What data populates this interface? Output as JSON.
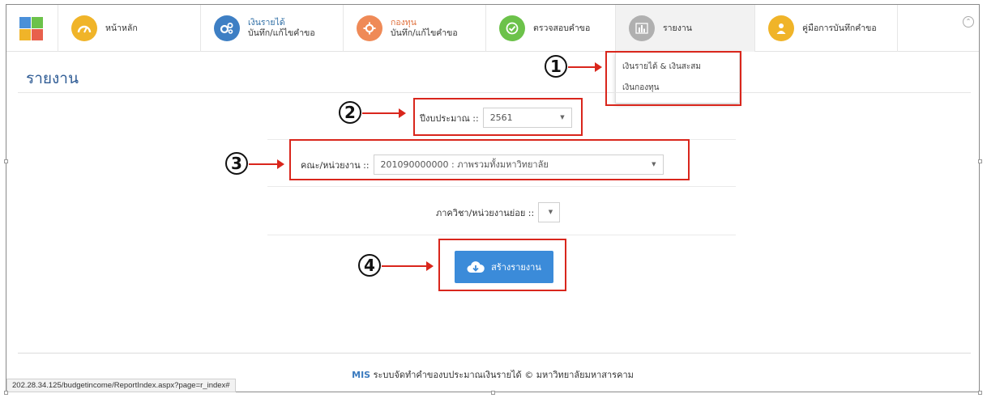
{
  "nav": {
    "items": [
      {
        "title": "หน้าหลัก",
        "sub": "",
        "title_color": "#333333",
        "icon": "dashboard-icon",
        "icon_color": "#f0b429",
        "active": false
      },
      {
        "title": "เงินรายได้",
        "sub": "บันทึก/แก้ไขคำขอ",
        "title_color": "#2e6da4",
        "icon": "gears-icon",
        "icon_color": "#3e7fc4",
        "active": false
      },
      {
        "title": "กองทุน",
        "sub": "บันทึก/แก้ไขคำขอ",
        "title_color": "#e0703c",
        "icon": "gear-icon",
        "icon_color": "#ef8a57",
        "active": false
      },
      {
        "title": "ตรวจสอบคำขอ",
        "sub": "",
        "title_color": "#333333",
        "icon": "check-icon",
        "icon_color": "#6cc24a",
        "active": false
      },
      {
        "title": "รายงาน",
        "sub": "",
        "title_color": "#333333",
        "icon": "bar-chart-icon",
        "icon_color": "#b0b0b0",
        "active": true
      },
      {
        "title": "คู่มือการบันทึกคำขอ",
        "sub": "",
        "title_color": "#333333",
        "icon": "users-icon",
        "icon_color": "#f0b429",
        "active": false
      }
    ],
    "collapse_icon": "chevron-up-circle-icon"
  },
  "report_menu": {
    "items": [
      "เงินรายได้ & เงินสะสม",
      "เงินกองทุน"
    ]
  },
  "page": {
    "title": "รายงาน"
  },
  "form": {
    "year_label": "ปีงบประมาณ ::",
    "year_value": "2561",
    "faculty_label": "คณะ/หน่วยงาน ::",
    "faculty_value": "201090000000 : ภาพรวมทั้งมหาวิทยาลัย",
    "dept_label": "ภาควิชา/หน่วยงานย่อย ::",
    "dept_value": "",
    "submit_label": "สร้างรายงาน",
    "submit_icon": "cloud-download-icon"
  },
  "annotations": [
    "1",
    "2",
    "3",
    "4"
  ],
  "footer": {
    "brand": "MIS",
    "text": "ระบบจัดทำคำของบประมาณเงินรายได้ © มหาวิทยาลัยมหาสารคาม"
  },
  "status_url": "202.28.34.125/budgetincome/ReportIndex.aspx?page=r_index#",
  "colors": {
    "accent": "#2e5b94",
    "button": "#3b8bd9",
    "annotation": "#d9261c"
  }
}
